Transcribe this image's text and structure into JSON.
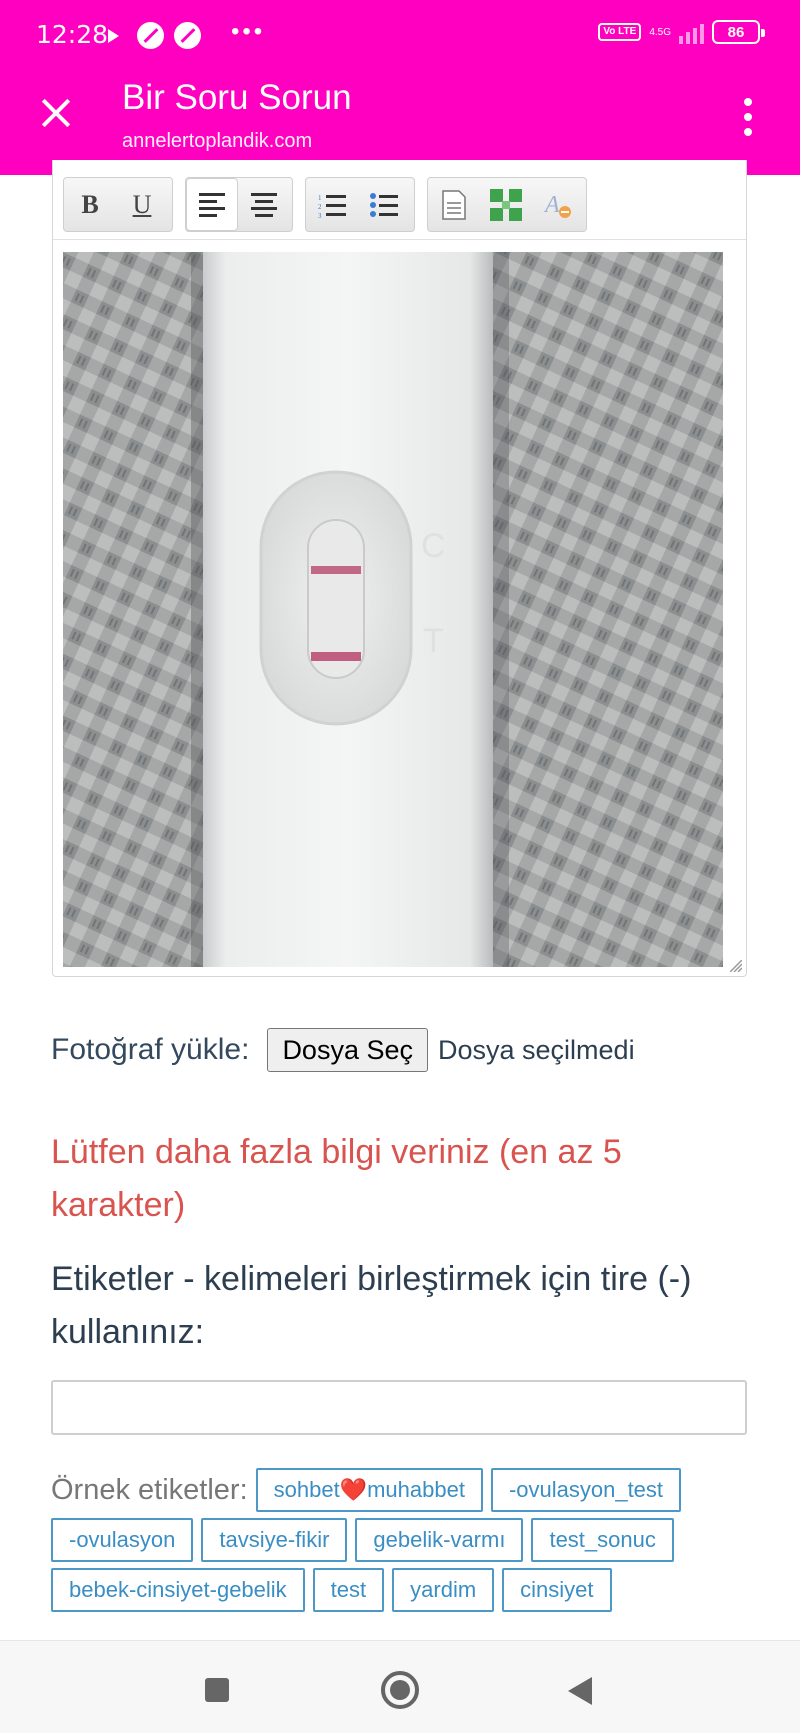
{
  "status_bar": {
    "time": "12:28",
    "network": "4.5G",
    "volte": "Vo LTE",
    "battery": "86"
  },
  "app_bar": {
    "title": "Bir Soru Sorun",
    "url": "annelertoplandik.com"
  },
  "editor": {
    "toolbar": {
      "bold_label": "B",
      "underline_label": "U"
    },
    "image_alt": "Pregnancy test photo with two lines"
  },
  "upload": {
    "label": "Fotoğraf yükle:",
    "button_label": "Dosya Seç",
    "status": "Dosya seçilmedi"
  },
  "error_message": "Lütfen daha fazla bilgi veriniz (en az 5 karakter)",
  "tags": {
    "label": "Etiketler - kelimeleri birleştirmek için tire (-) kullanınız:",
    "input_value": "",
    "examples_label": "Örnek etiketler:",
    "examples": [
      "sohbet❤️muhabbet",
      "-ovulasyon_test",
      "-ovulasyon",
      "tavsiye-fikir",
      "gebelik-varmı",
      "test_sonuc",
      "bebek-cinsiyet-gebelik",
      "test",
      "yardim",
      "cinsiyet"
    ]
  },
  "colors": {
    "app_bar": "#ff00c0",
    "error": "#d9534f",
    "tag_chip": "#3a8ec4",
    "test_line": "#b8476e"
  }
}
